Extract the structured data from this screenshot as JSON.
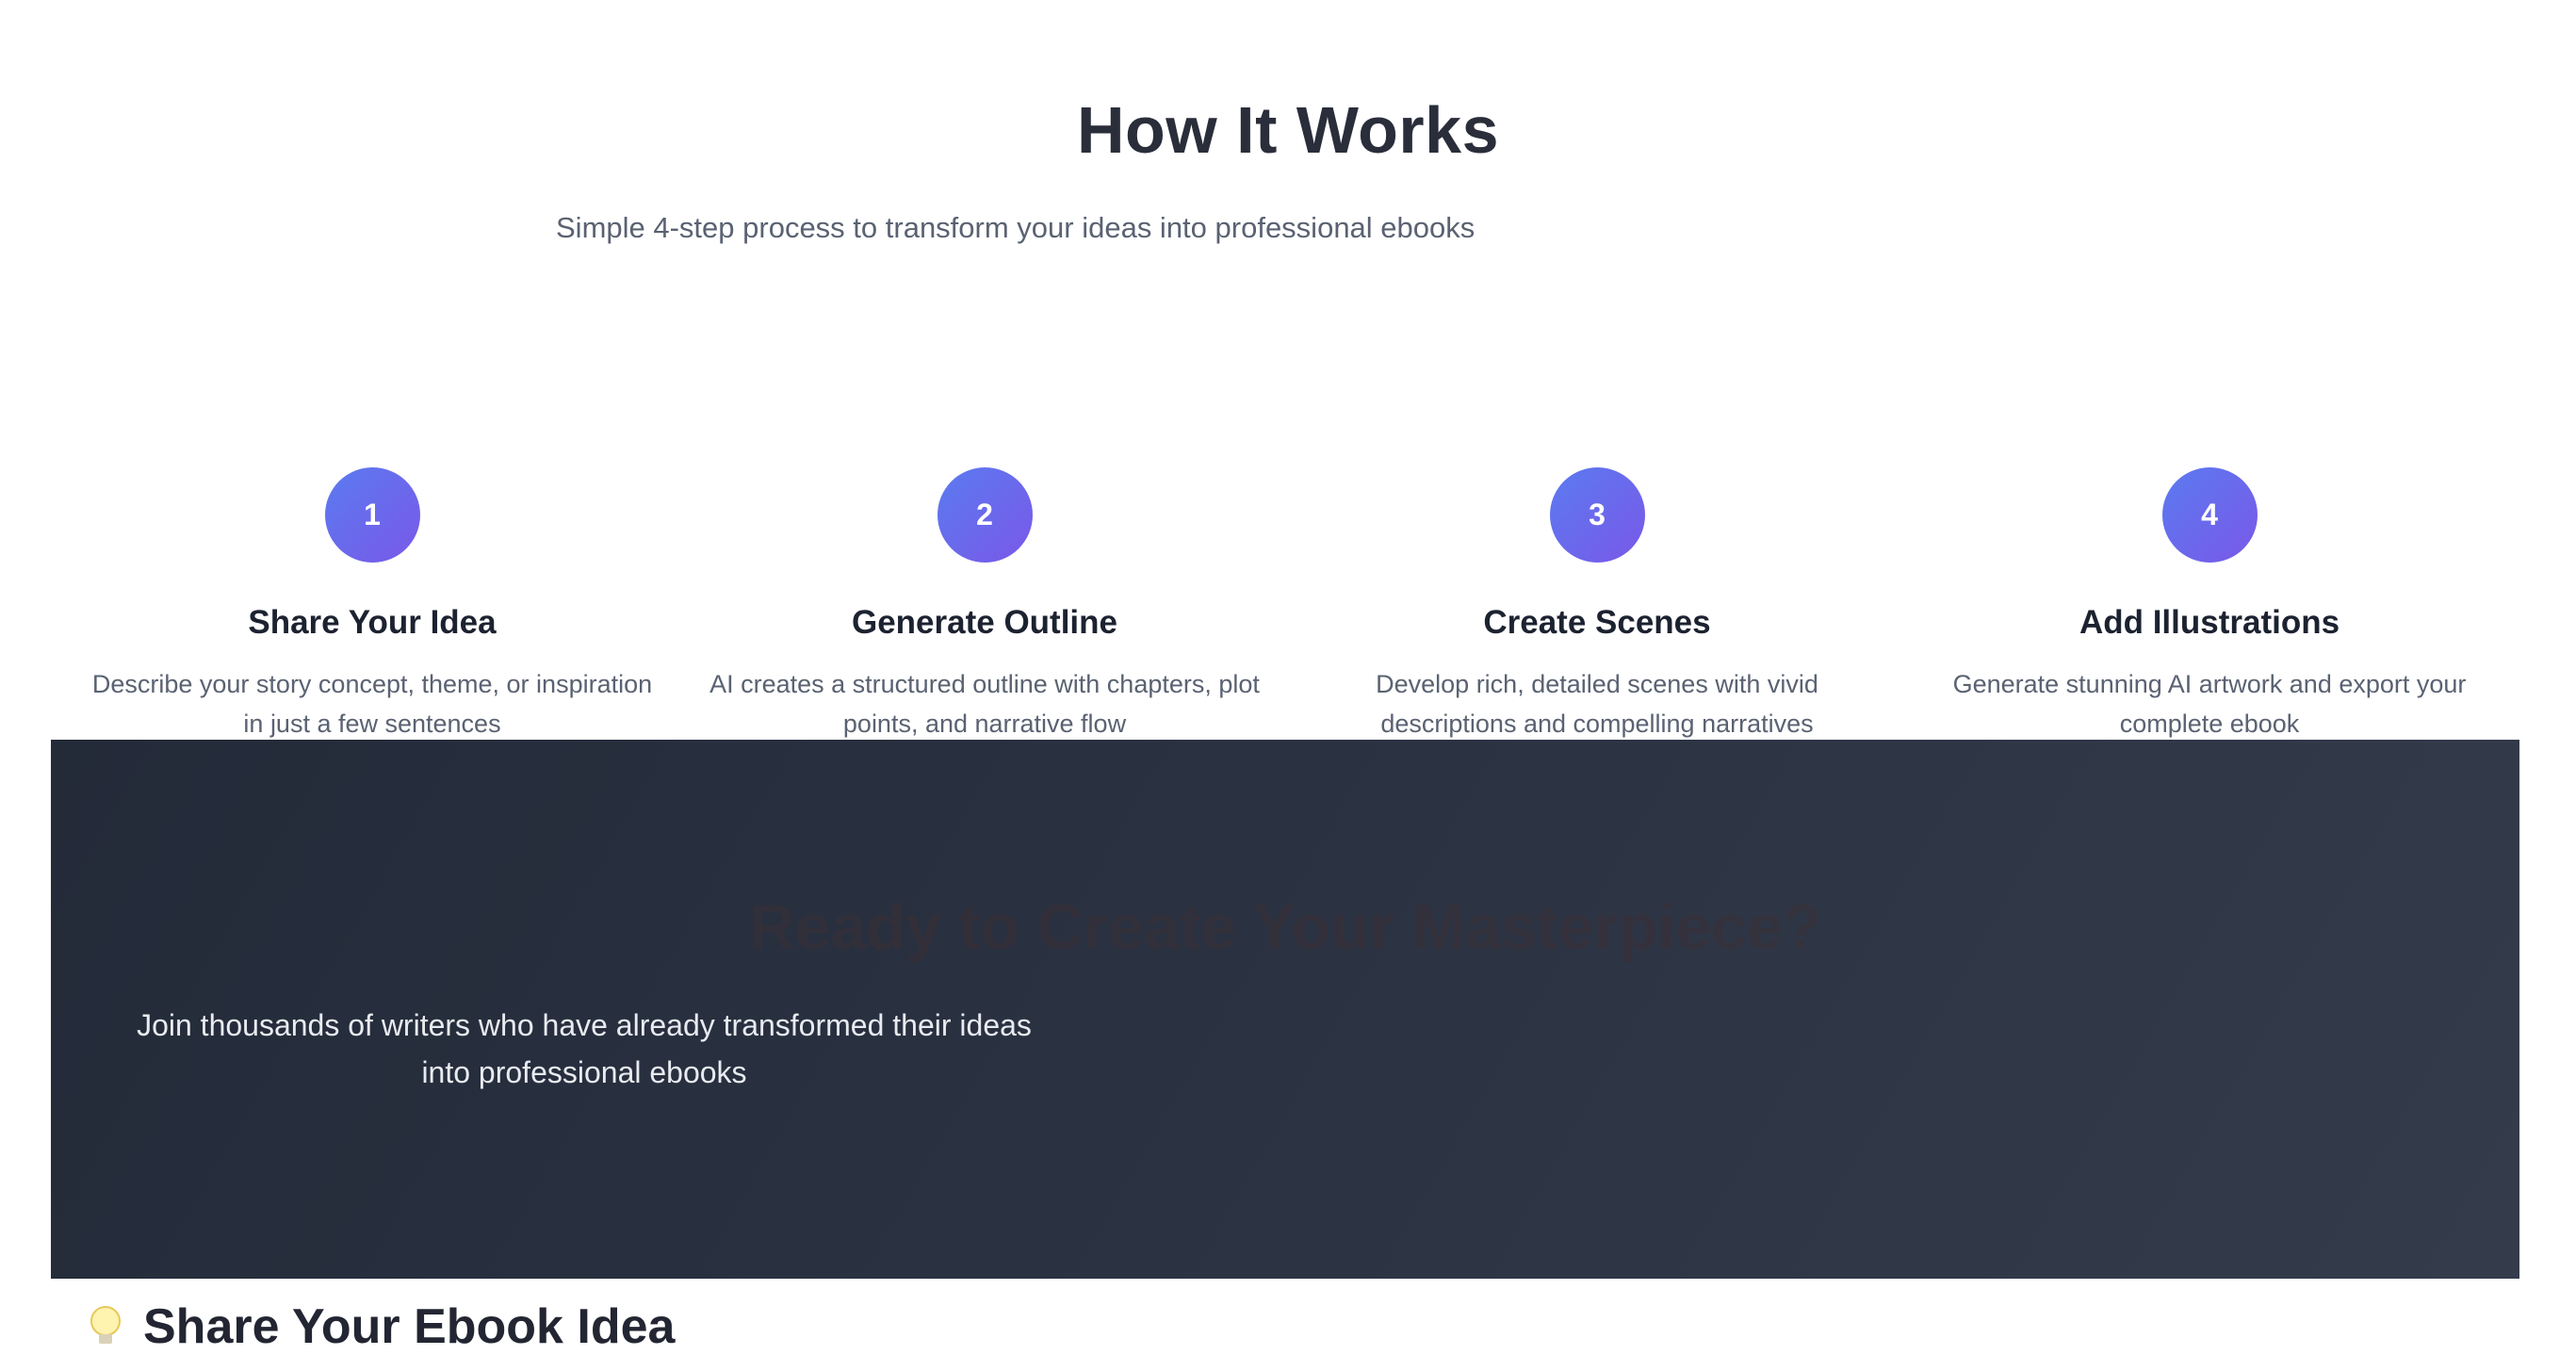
{
  "how_it_works": {
    "title": "How It Works",
    "subtitle": "Simple 4-step process to transform your ideas into professional ebooks",
    "steps": [
      {
        "number": "1",
        "title": "Share Your Idea",
        "description": "Describe your story concept, theme, or inspiration in just a few sentences"
      },
      {
        "number": "2",
        "title": "Generate Outline",
        "description": "AI creates a structured outline with chapters, plot points, and narrative flow"
      },
      {
        "number": "3",
        "title": "Create Scenes",
        "description": "Develop rich, detailed scenes with vivid descriptions and compelling narratives"
      },
      {
        "number": "4",
        "title": "Add Illustrations",
        "description": "Generate stunning AI artwork and export your complete ebook"
      }
    ],
    "step_gradient": [
      "#5a7bf0",
      "#7a58e8"
    ]
  },
  "cta": {
    "title": "Ready to Create Your Masterpiece?",
    "description": "Join thousands of writers who have already transformed their ideas into professional ebooks",
    "background": [
      "#232a38",
      "#343c4c"
    ]
  },
  "idea_section": {
    "icon": "lightbulb-icon",
    "title": "Share Your Ebook Idea"
  }
}
